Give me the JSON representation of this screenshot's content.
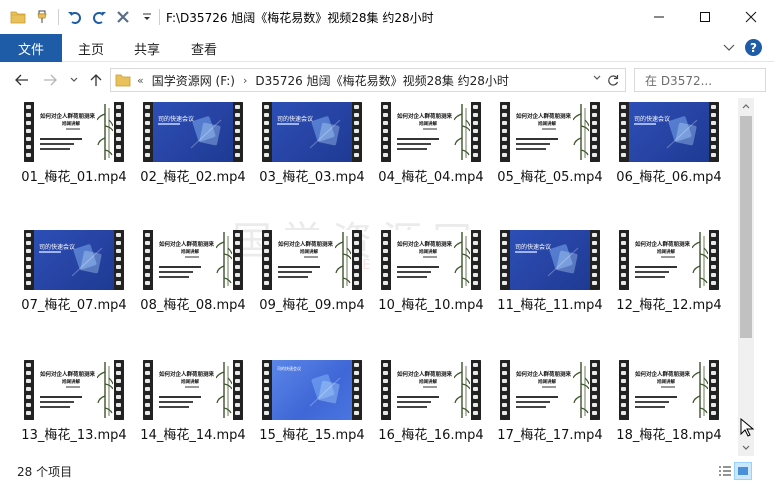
{
  "window": {
    "title": "F:\\D35726 旭阔《梅花易数》视频28集 约28小时"
  },
  "ribbon": {
    "tabs": [
      "文件",
      "主页",
      "共享",
      "查看"
    ]
  },
  "nav": {
    "breadcrumb": [
      "国学资源网 (F:)",
      "D35726 旭阔《梅花易数》视频28集 约28小时"
    ],
    "search_placeholder": "在 D3572..."
  },
  "watermark": {
    "main": "国学资源网",
    "sub": "GUOXUE"
  },
  "files": [
    {
      "name": "01_梅花_01.mp4",
      "thumb": "white"
    },
    {
      "name": "02_梅花_02.mp4",
      "thumb": "blue"
    },
    {
      "name": "03_梅花_03.mp4",
      "thumb": "blue"
    },
    {
      "name": "04_梅花_04.mp4",
      "thumb": "white"
    },
    {
      "name": "05_梅花_05.mp4",
      "thumb": "white"
    },
    {
      "name": "06_梅花_06.mp4",
      "thumb": "blue"
    },
    {
      "name": "07_梅花_07.mp4",
      "thumb": "blue"
    },
    {
      "name": "08_梅花_08.mp4",
      "thumb": "white"
    },
    {
      "name": "09_梅花_09.mp4",
      "thumb": "white"
    },
    {
      "name": "10_梅花_10.mp4",
      "thumb": "white"
    },
    {
      "name": "11_梅花_11.mp4",
      "thumb": "blue"
    },
    {
      "name": "12_梅花_12.mp4",
      "thumb": "white"
    },
    {
      "name": "13_梅花_13.mp4",
      "thumb": "white"
    },
    {
      "name": "14_梅花_14.mp4",
      "thumb": "white"
    },
    {
      "name": "15_梅花_15.mp4",
      "thumb": "light"
    },
    {
      "name": "16_梅花_16.mp4",
      "thumb": "white"
    },
    {
      "name": "17_梅花_17.mp4",
      "thumb": "white"
    },
    {
      "name": "18_梅花_18.mp4",
      "thumb": "white"
    }
  ],
  "thumb_text": {
    "white_title": "如何对企人群荷朋测来",
    "white_sub": "旭阔讲解",
    "blue_title": "司的快速会议"
  },
  "status": {
    "item_count": "28 个项目"
  },
  "colors": {
    "accent": "#1e5ca8",
    "selection": "#cce8ff"
  }
}
